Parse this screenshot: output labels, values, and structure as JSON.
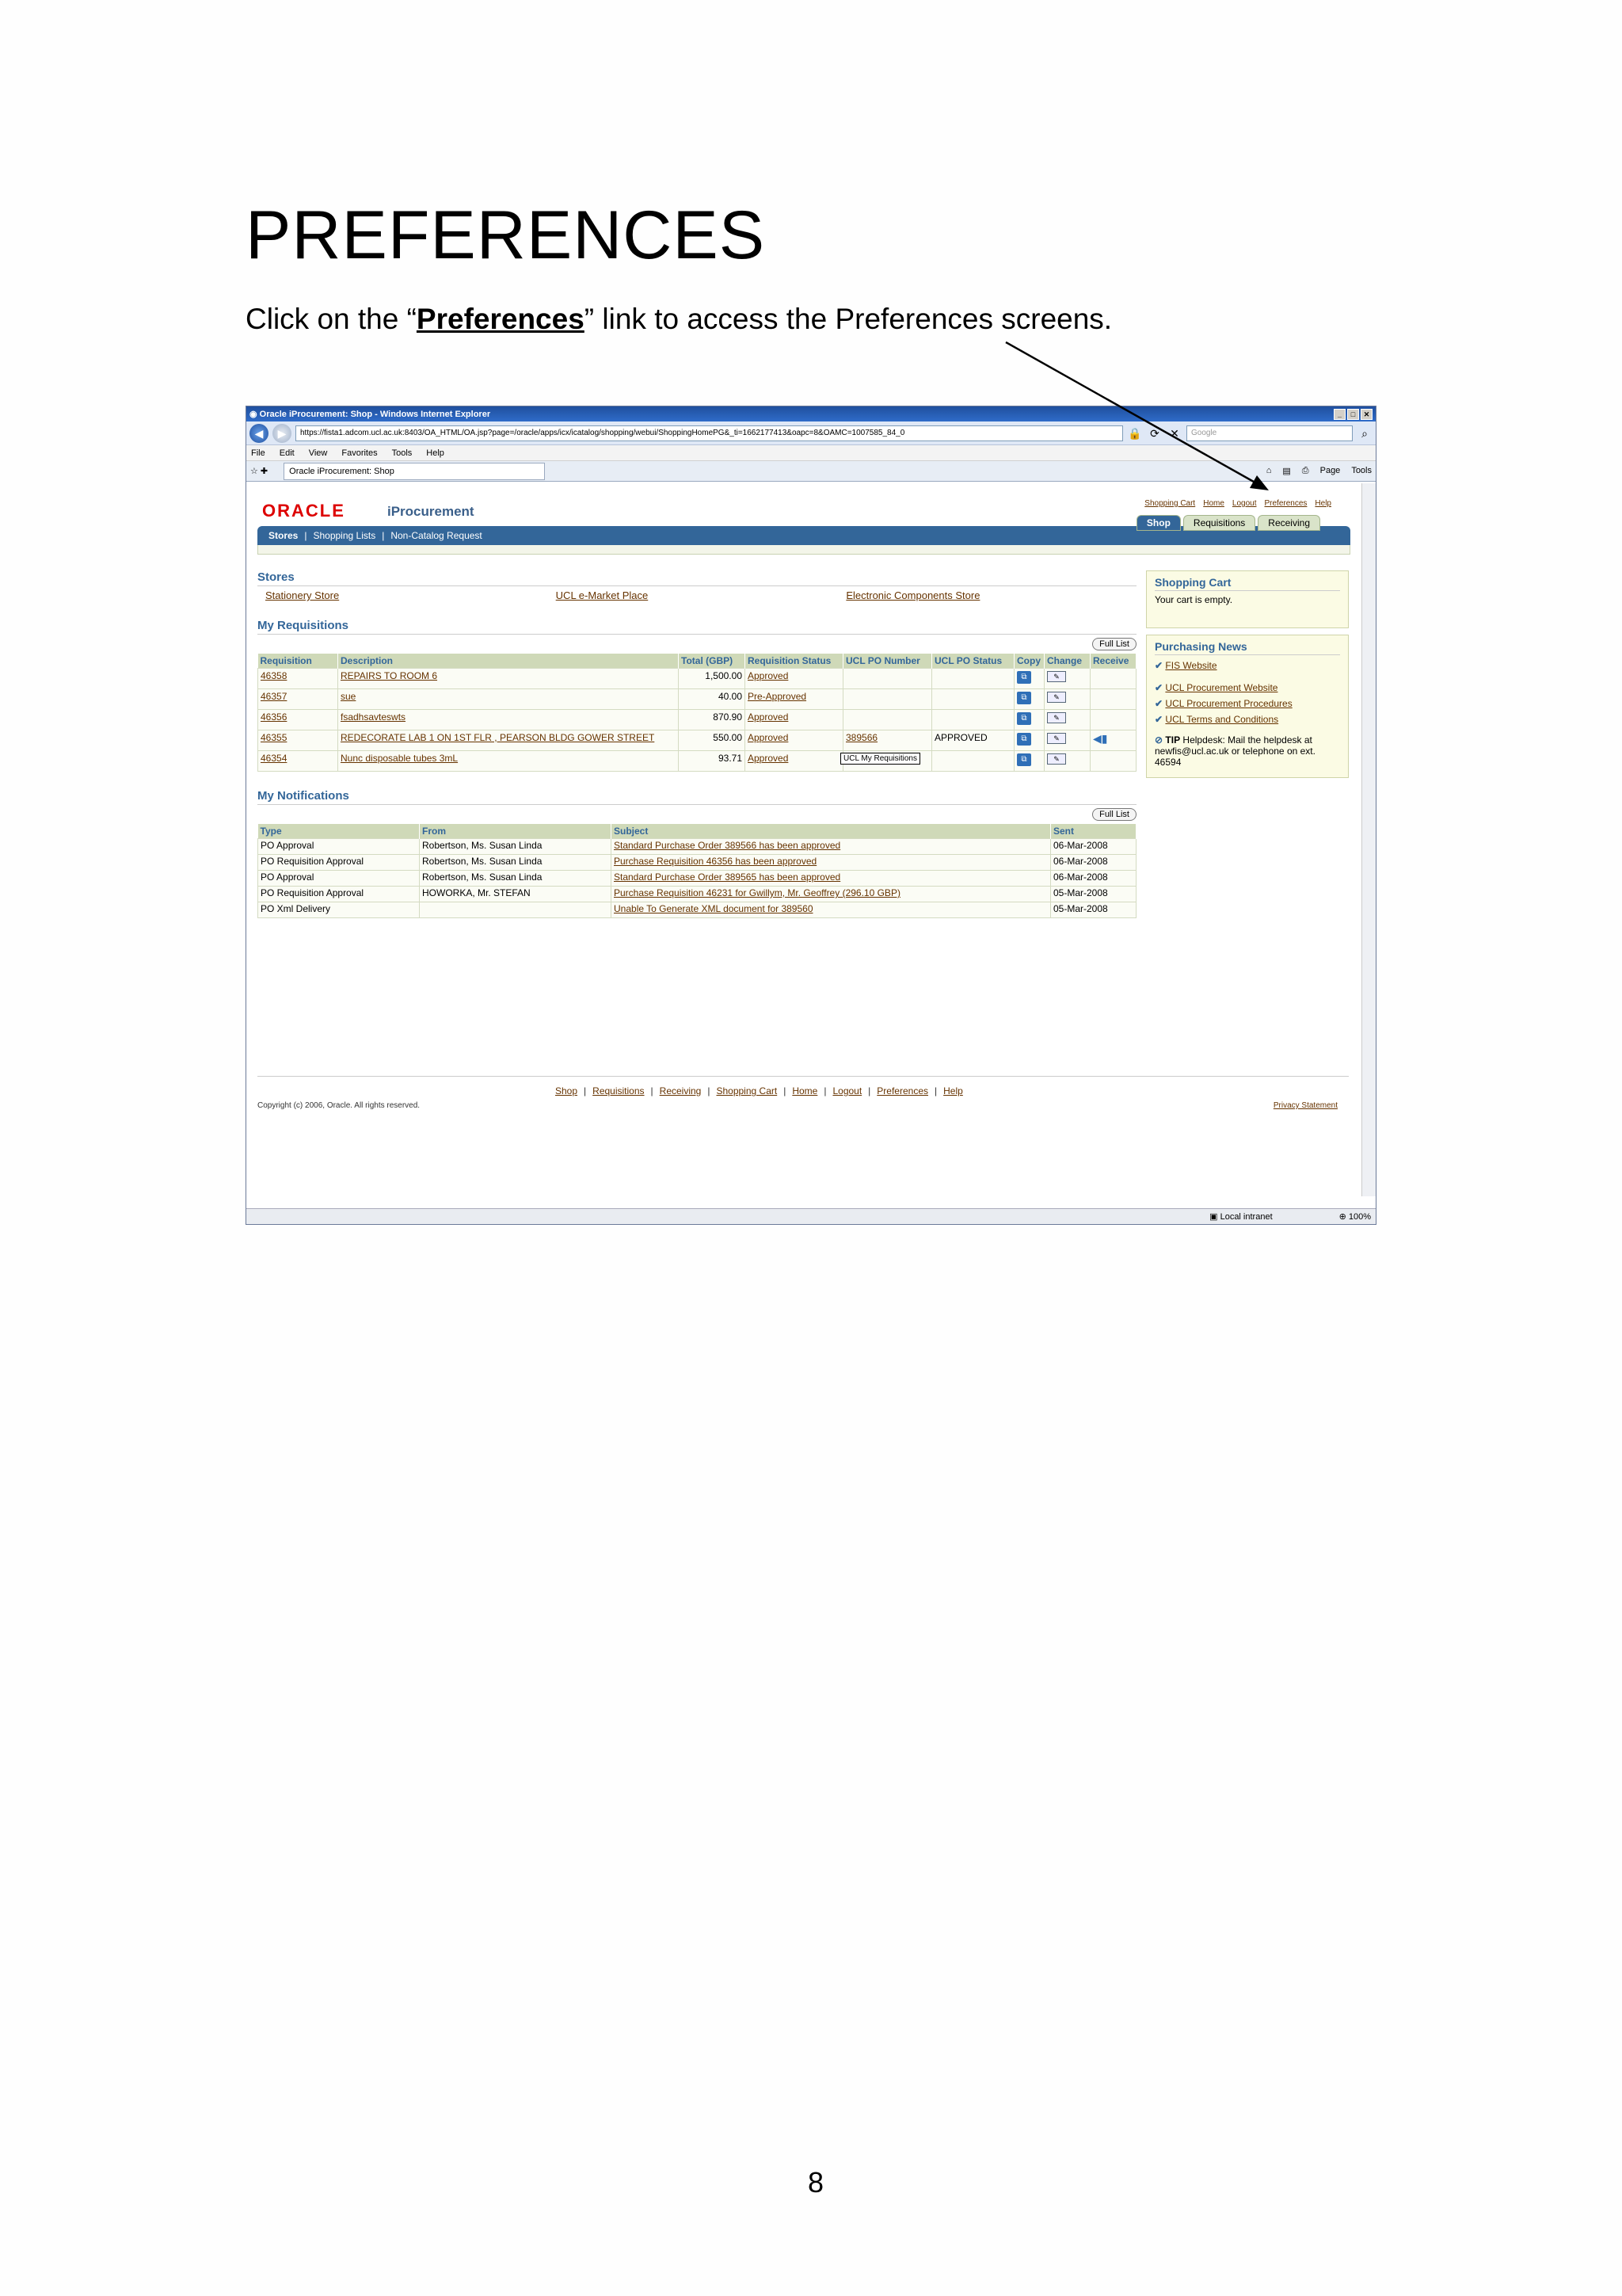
{
  "doc": {
    "title": "PREFERENCES",
    "instruction_pre": "Click on the “",
    "instruction_link": "Preferences",
    "instruction_post": "” link to access the Preferences screens.",
    "page_number": "8"
  },
  "browser": {
    "title": "Oracle iProcurement: Shop - Windows Internet Explorer",
    "url": "https://fista1.adcom.ucl.ac.uk:8403/OA_HTML/OA.jsp?page=/oracle/apps/icx/icatalog/shopping/webui/ShoppingHomePG&_ti=1662177413&oapc=8&OAMC=1007585_84_0",
    "search_placeholder": "Google",
    "menu": [
      "File",
      "Edit",
      "View",
      "Favorites",
      "Tools",
      "Help"
    ],
    "tab_label": "Oracle iProcurement: Shop",
    "tools": [
      "Page",
      "Tools"
    ],
    "status_zone": "Local intranet",
    "zoom": "100%"
  },
  "app": {
    "logo": "ORACLE",
    "product": "iProcurement",
    "global_links": [
      "Shopping Cart",
      "Home",
      "Logout",
      "Preferences",
      "Help"
    ],
    "tabs": [
      "Shop",
      "Requisitions",
      "Receiving"
    ],
    "subnav": [
      "Stores",
      "Shopping Lists",
      "Non-Catalog Request"
    ],
    "stores_heading": "Stores",
    "stores": [
      "Stationery Store",
      "UCL e-Market Place",
      "Electronic Components Store"
    ],
    "requisitions_heading": "My Requisitions",
    "full_list": "Full List",
    "req_columns": {
      "requisition": "Requisition",
      "description": "Description",
      "total": "Total (GBP)",
      "status": "Requisition Status",
      "po_number": "UCL PO Number",
      "po_status": "UCL PO Status",
      "copy": "Copy",
      "change": "Change",
      "receive": "Receive"
    },
    "requisitions": [
      {
        "id": "46358",
        "desc": "REPAIRS TO ROOM 6",
        "total": "1,500.00",
        "status": "Approved",
        "po": "",
        "po_status": ""
      },
      {
        "id": "46357",
        "desc": "sue",
        "total": "40.00",
        "status": "Pre-Approved",
        "po": "",
        "po_status": ""
      },
      {
        "id": "46356",
        "desc": "fsadhsavteswts",
        "total": "870.90",
        "status": "Approved",
        "po": "",
        "po_status": ""
      },
      {
        "id": "46355",
        "desc": "REDECORATE LAB 1 ON 1ST FLR , PEARSON BLDG GOWER STREET",
        "total": "550.00",
        "status": "Approved",
        "po": "389566",
        "po_status": "APPROVED"
      },
      {
        "id": "46354",
        "desc": "Nunc disposable tubes 3mL",
        "total": "93.71",
        "status": "Approved",
        "po": "",
        "po_status": ""
      }
    ],
    "tooltip": "UCL My Requisitions",
    "notifications_heading": "My Notifications",
    "notif_columns": {
      "type": "Type",
      "from": "From",
      "subject": "Subject",
      "sent": "Sent"
    },
    "notifications": [
      {
        "type": "PO Approval",
        "from": "Robertson, Ms. Susan Linda",
        "subject": "Standard Purchase Order 389566 has been approved",
        "sent": "06-Mar-2008"
      },
      {
        "type": "PO Requisition Approval",
        "from": "Robertson, Ms. Susan Linda",
        "subject": "Purchase Requisition 46356 has been approved",
        "sent": "06-Mar-2008"
      },
      {
        "type": "PO Approval",
        "from": "Robertson, Ms. Susan Linda",
        "subject": "Standard Purchase Order 389565 has been approved",
        "sent": "06-Mar-2008"
      },
      {
        "type": "PO Requisition Approval",
        "from": "HOWORKA, Mr. STEFAN",
        "subject": "Purchase Requisition 46231 for Gwillym, Mr. Geoffrey (296.10 GBP)",
        "sent": "05-Mar-2008"
      },
      {
        "type": "PO Xml Delivery",
        "from": "",
        "subject": "Unable To Generate XML document for 389560",
        "sent": "05-Mar-2008"
      }
    ],
    "cart_heading": "Shopping Cart",
    "cart_text": "Your cart is empty.",
    "news_heading": "Purchasing News",
    "news": [
      "FIS Website",
      "UCL Procurement Website",
      "UCL Procurement Procedures",
      "UCL Terms and Conditions"
    ],
    "tip_label": "TIP",
    "tip_text": "Helpdesk: Mail the helpdesk at newfis@ucl.ac.uk or telephone on ext. 46594",
    "footer_links": [
      "Shop",
      "Requisitions",
      "Receiving",
      "Shopping Cart",
      "Home",
      "Logout",
      "Preferences",
      "Help"
    ],
    "copyright": "Copyright (c) 2006, Oracle. All rights reserved.",
    "privacy": "Privacy Statement"
  }
}
